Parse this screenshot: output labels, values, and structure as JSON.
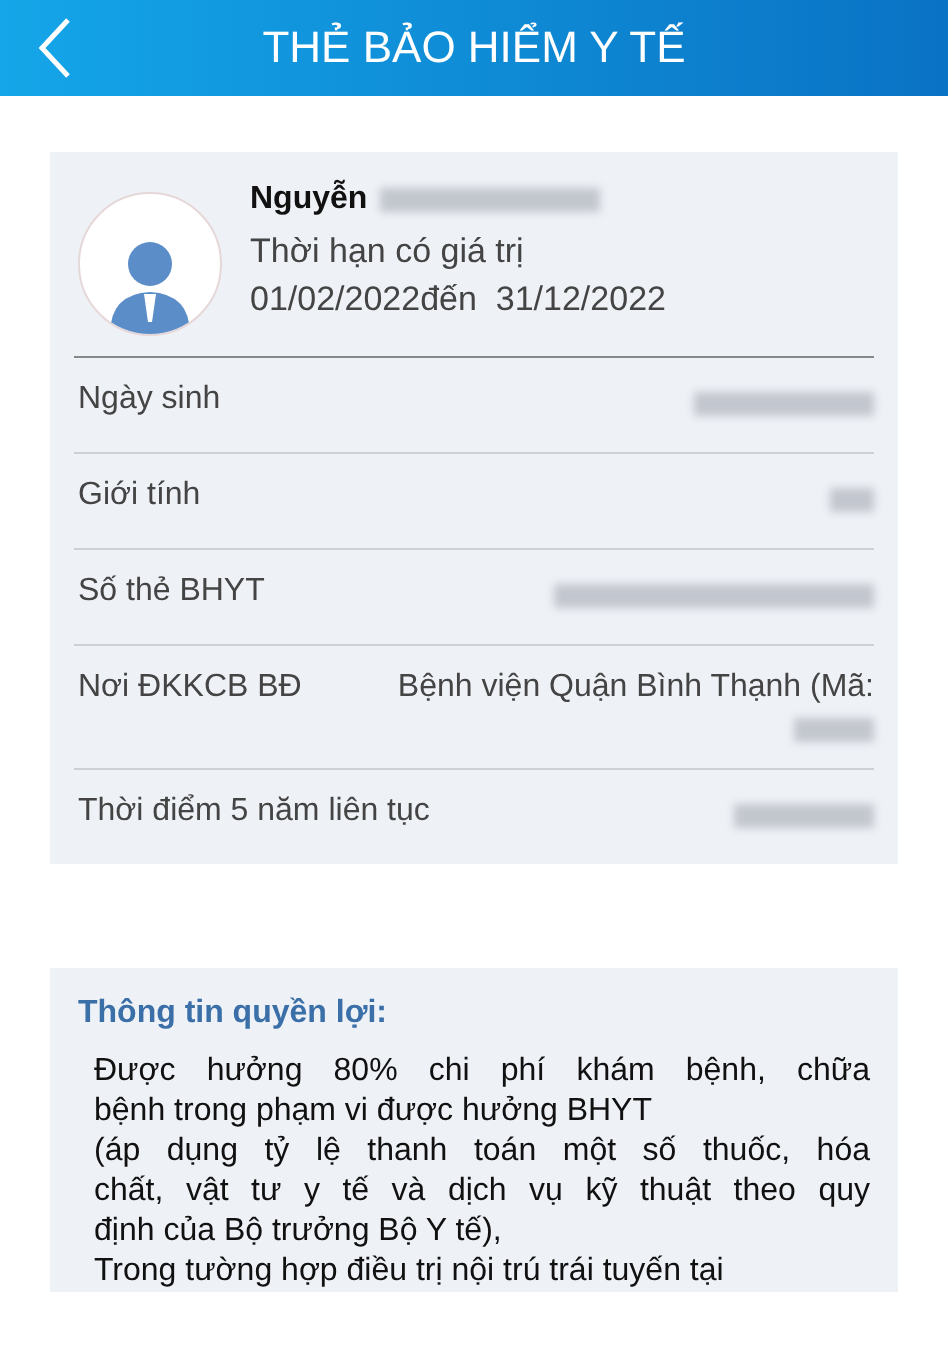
{
  "header": {
    "title": "THẺ BẢO HIỂM Y TẾ"
  },
  "card": {
    "name": "Nguyễn",
    "name_redacted": true,
    "validity_label": "Thời hạn có giá trị",
    "validity_dates": "01/02/2022đến  31/12/2022",
    "fields": [
      {
        "label": "Ngày sinh",
        "redacted": true
      },
      {
        "label": "Giới tính",
        "redacted": true
      },
      {
        "label": "Số thẻ BHYT",
        "redacted": true
      },
      {
        "label": "Nơi ĐKKCB BĐ",
        "value": "Bệnh viện Quận Bình Thạnh (Mã:",
        "redacted": true
      },
      {
        "label": "Thời điểm 5 năm liên tục",
        "redacted": true
      }
    ]
  },
  "benefits": {
    "title": "Thông tin quyền lợi:",
    "lines": [
      "Được hưởng 80% chi phí khám bệnh, chữa",
      "bệnh trong phạm vi được hưởng BHYT",
      "(áp dụng tỷ lệ thanh toán một số thuốc, hóa",
      "chất, vật tư y tế và dịch vụ kỹ thuật theo quy",
      "định của Bộ trưởng Bộ Y tế),",
      "Trong tường hợp điều trị nội trú trái tuyến tại"
    ]
  }
}
